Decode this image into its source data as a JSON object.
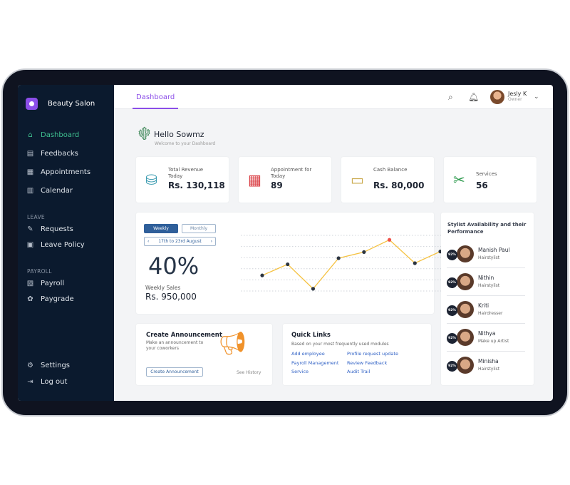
{
  "sidebar": {
    "brand": "Beauty Salon",
    "items": [
      {
        "label": "Dashboard",
        "icon": "home-icon"
      },
      {
        "label": "Feedbacks",
        "icon": "feedback-icon"
      },
      {
        "label": "Appointments",
        "icon": "appointments-icon"
      },
      {
        "label": "Calendar",
        "icon": "calendar-icon"
      }
    ],
    "leave_title": "LEAVE",
    "leave_items": [
      {
        "label": "Requests",
        "icon": "requests-icon"
      },
      {
        "label": "Leave Policy",
        "icon": "leave-policy-icon"
      }
    ],
    "payroll_title": "PAYROLL",
    "payroll_items": [
      {
        "label": "Payroll",
        "icon": "payroll-icon"
      },
      {
        "label": "Paygrade",
        "icon": "paygrade-icon"
      }
    ],
    "settings": "Settings",
    "logout": "Log out"
  },
  "header": {
    "tab": "Dashboard",
    "user_name": "Jesly K",
    "user_role": "Owner"
  },
  "greeting": {
    "title": "Hello Sowmz",
    "subtitle": "Welcome to your Dashboard"
  },
  "stats": [
    {
      "label": "Total Revenue Today",
      "value": "Rs. 130,118",
      "color": "#3a9bb0"
    },
    {
      "label": "Appointment for Today",
      "value": "89",
      "color": "#d9393f"
    },
    {
      "label": "Cash Balance",
      "value": "Rs. 80,000",
      "color": "#c9a84a"
    },
    {
      "label": "Services",
      "value": "56",
      "color": "#2e9a4e"
    }
  ],
  "sales": {
    "weekly": "Weekly",
    "monthly": "Monthly",
    "range": "17th to 23rd August",
    "percent": "40%",
    "label": "Weekly Sales",
    "amount": "Rs. 950,000"
  },
  "chart_data": {
    "type": "line",
    "values": [
      1.4,
      2.4,
      0.2,
      2.95,
      3.5,
      4.6,
      2.5,
      3.55
    ],
    "ylim": [
      0,
      5
    ],
    "grid": true,
    "line_color": "#f5c242",
    "point_color": "#2b3440",
    "highlight_index": 5,
    "highlight_color": "#f0524a"
  },
  "announcement": {
    "title": "Create Announcement",
    "desc": "Make an announcement to your coworkers",
    "button": "Create Announcement",
    "history": "See History"
  },
  "quick_links": {
    "title": "Quick Links",
    "subtitle": "Based on your most frequently used modules",
    "links": [
      "Add employee",
      "Profile request update",
      "Payroll Management",
      "Review Feedback",
      "Service",
      "Audit Trail"
    ]
  },
  "stylists": {
    "title": "Stylist Availability and their Performance",
    "items": [
      {
        "name": "Manish Paul",
        "role": "Hairstylist",
        "pct": "92%"
      },
      {
        "name": "Nithin",
        "role": "Hairstylist",
        "pct": "92%"
      },
      {
        "name": "Kriti",
        "role": "Hairdresser",
        "pct": "92%"
      },
      {
        "name": "Nithya",
        "role": "Make up Artist",
        "pct": "92%"
      },
      {
        "name": "Minisha",
        "role": "Hairstylist",
        "pct": "92%"
      }
    ]
  }
}
